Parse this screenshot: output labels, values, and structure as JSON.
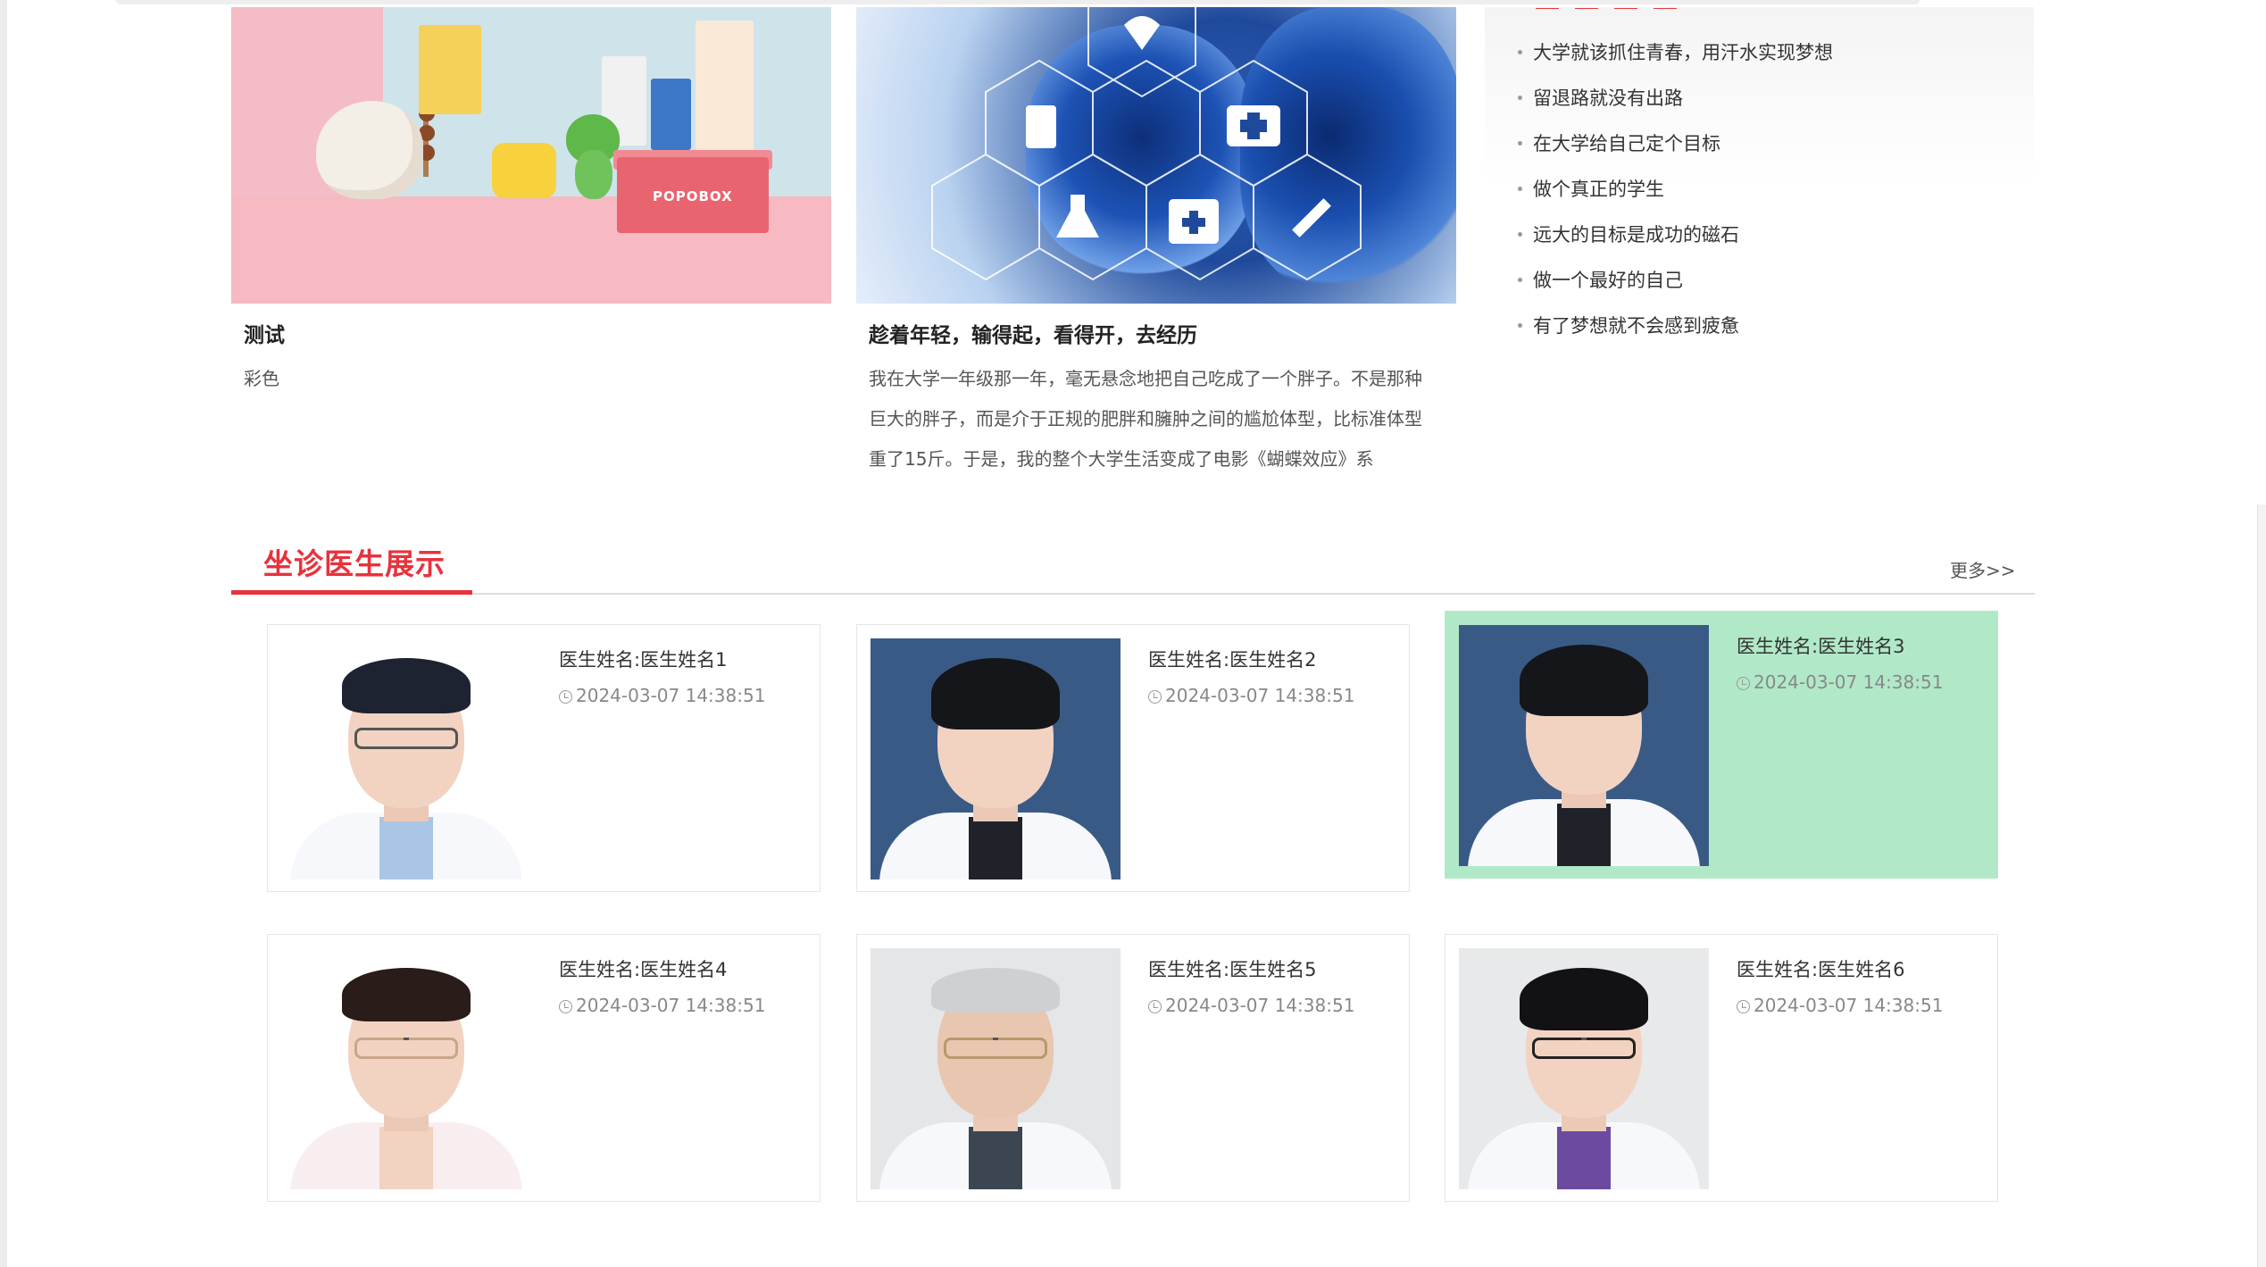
{
  "top_cards": [
    {
      "title": "测试",
      "desc": "彩色",
      "thumb_text": "POPOBOX"
    },
    {
      "title": "趁着年轻，输得起，看得开，去经历",
      "desc": "我在大学一年级那一年，毫无悬念地把自己吃成了一个胖子。不是那种巨大的胖子，而是介于正规的肥胖和臃肿之间的尴尬体型，比标准体型重了15斤。于是，我的整个大学生活变成了电影《蝴蝶效应》系"
    }
  ],
  "list": {
    "items": [
      "大学就该抓住青春，用汗水实现梦想",
      "留退路就没有出路",
      "在大学给自己定个目标",
      "做个真正的学生",
      "远大的目标是成功的磁石",
      "做一个最好的自己",
      "有了梦想就不会感到疲惫"
    ]
  },
  "section": {
    "title": "坐诊医生展示",
    "more": "更多>>"
  },
  "doctors": [
    {
      "name": "医生姓名:医生姓名1",
      "date": "2024-03-07 14:38:51",
      "active": false
    },
    {
      "name": "医生姓名:医生姓名2",
      "date": "2024-03-07 14:38:51",
      "active": false
    },
    {
      "name": "医生姓名:医生姓名3",
      "date": "2024-03-07 14:38:51",
      "active": true
    },
    {
      "name": "医生姓名:医生姓名4",
      "date": "2024-03-07 14:38:51",
      "active": false
    },
    {
      "name": "医生姓名:医生姓名5",
      "date": "2024-03-07 14:38:51",
      "active": false
    },
    {
      "name": "医生姓名:医生姓名6",
      "date": "2024-03-07 14:38:51",
      "active": false
    }
  ],
  "colors": {
    "accent": "#e8323c",
    "active_card": "#b1e9c8"
  }
}
